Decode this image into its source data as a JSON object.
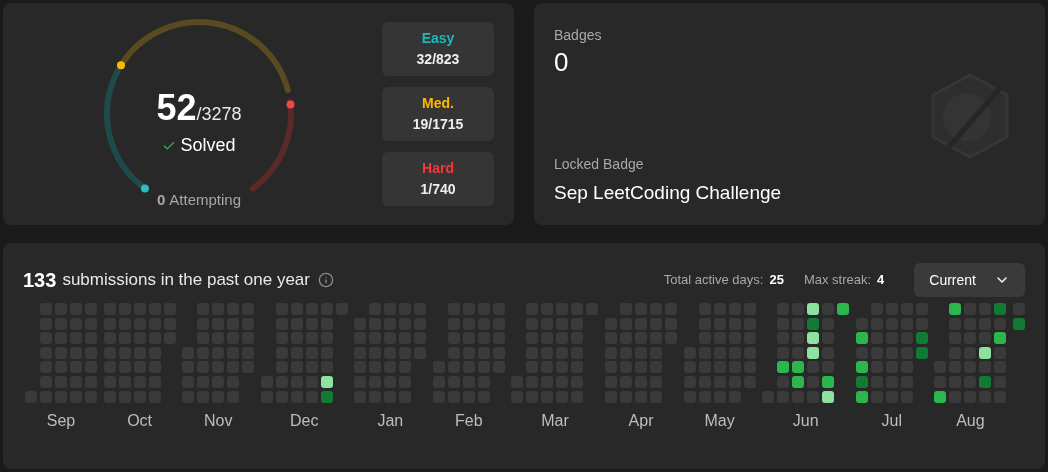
{
  "solved": {
    "count": "52",
    "total": "/3278",
    "label": "Solved",
    "attempting_count": "0",
    "attempting_label": "Attempting"
  },
  "difficulties": [
    {
      "label": "Easy",
      "value": "32/823",
      "color": "#1cbaba"
    },
    {
      "label": "Med.",
      "value": "19/1715",
      "color": "#ffb700"
    },
    {
      "label": "Hard",
      "value": "1/740",
      "color": "#f63737"
    }
  ],
  "badges": {
    "title": "Badges",
    "count": "0",
    "locked_label": "Locked Badge",
    "locked_name": "Sep LeetCoding Challenge"
  },
  "activity": {
    "count": "133",
    "text": "submissions in the past one year",
    "total_active_label": "Total active days:",
    "total_active_value": "25",
    "max_streak_label": "Max streak:",
    "max_streak_value": "4",
    "dropdown": "Current",
    "months": [
      {
        "label": "Sep",
        "weeks": [
          [
            {
              "color": "#3a3a3a"
            }
          ],
          [
            {
              "color": "#3a3a3a"
            },
            {
              "color": "#3a3a3a"
            },
            {
              "color": "#3a3a3a"
            },
            {
              "color": "#3a3a3a"
            },
            {
              "color": "#3a3a3a"
            },
            {
              "color": "#3a3a3a"
            },
            {
              "color": "#3a3a3a"
            }
          ],
          [
            {
              "color": "#3a3a3a"
            },
            {
              "color": "#3a3a3a"
            },
            {
              "color": "#3a3a3a"
            },
            {
              "color": "#3a3a3a"
            },
            {
              "color": "#3a3a3a"
            },
            {
              "color": "#3a3a3a"
            },
            {
              "color": "#3a3a3a"
            }
          ],
          [
            {
              "color": "#3a3a3a"
            },
            {
              "color": "#3a3a3a"
            },
            {
              "color": "#3a3a3a"
            },
            {
              "color": "#3a3a3a"
            },
            {
              "color": "#3a3a3a"
            },
            {
              "color": "#3a3a3a"
            },
            {
              "color": "#3a3a3a"
            }
          ],
          [
            {
              "color": "#3a3a3a"
            },
            {
              "color": "#3a3a3a"
            },
            {
              "color": "#3a3a3a"
            },
            {
              "color": "#3a3a3a"
            },
            {
              "color": "#3a3a3a"
            },
            {
              "color": "#3a3a3a"
            },
            {
              "color": "#3a3a3a"
            }
          ]
        ]
      },
      {
        "label": "Oct",
        "weeks": [
          [
            {
              "color": "#3a3a3a"
            },
            {
              "color": "#3a3a3a"
            },
            {
              "color": "#3a3a3a"
            },
            {
              "color": "#3a3a3a"
            },
            {
              "color": "#3a3a3a"
            },
            {
              "color": "#3a3a3a"
            },
            {
              "color": "#3a3a3a"
            }
          ],
          [
            {
              "color": "#3a3a3a"
            },
            {
              "color": "#3a3a3a"
            },
            {
              "color": "#3a3a3a"
            },
            {
              "color": "#3a3a3a"
            },
            {
              "color": "#3a3a3a"
            },
            {
              "color": "#3a3a3a"
            },
            {
              "color": "#3a3a3a"
            }
          ],
          [
            {
              "color": "#3a3a3a"
            },
            {
              "color": "#3a3a3a"
            },
            {
              "color": "#3a3a3a"
            },
            {
              "color": "#3a3a3a"
            },
            {
              "color": "#3a3a3a"
            },
            {
              "color": "#3a3a3a"
            },
            {
              "color": "#3a3a3a"
            }
          ],
          [
            {
              "color": "#3a3a3a"
            },
            {
              "color": "#3a3a3a"
            },
            {
              "color": "#3a3a3a"
            },
            {
              "color": "#3a3a3a"
            },
            {
              "color": "#3a3a3a"
            },
            {
              "color": "#3a3a3a"
            },
            {
              "color": "#3a3a3a"
            }
          ],
          [
            {
              "color": "#3a3a3a"
            },
            {
              "color": "#3a3a3a"
            },
            {
              "color": "#3a3a3a"
            }
          ]
        ]
      },
      {
        "label": "Nov",
        "weeks": [
          [
            {
              "color": "#3a3a3a"
            },
            {
              "color": "#3a3a3a"
            },
            {
              "color": "#3a3a3a"
            },
            {
              "color": "#3a3a3a"
            }
          ],
          [
            {
              "color": "#3a3a3a"
            },
            {
              "color": "#3a3a3a"
            },
            {
              "color": "#3a3a3a"
            },
            {
              "color": "#3a3a3a"
            },
            {
              "color": "#3a3a3a"
            },
            {
              "color": "#3a3a3a"
            },
            {
              "color": "#3a3a3a"
            }
          ],
          [
            {
              "color": "#3a3a3a"
            },
            {
              "color": "#3a3a3a"
            },
            {
              "color": "#3a3a3a"
            },
            {
              "color": "#3a3a3a"
            },
            {
              "color": "#3a3a3a"
            },
            {
              "color": "#3a3a3a"
            },
            {
              "color": "#3a3a3a"
            }
          ],
          [
            {
              "color": "#3a3a3a"
            },
            {
              "color": "#3a3a3a"
            },
            {
              "color": "#3a3a3a"
            },
            {
              "color": "#3a3a3a"
            },
            {
              "color": "#3a3a3a"
            },
            {
              "color": "#3a3a3a"
            },
            {
              "color": "#3a3a3a"
            }
          ],
          [
            {
              "color": "#3a3a3a"
            },
            {
              "color": "#3a3a3a"
            },
            {
              "color": "#3a3a3a"
            },
            {
              "color": "#3a3a3a"
            },
            {
              "color": "#3a3a3a"
            }
          ]
        ]
      },
      {
        "label": "Dec",
        "weeks": [
          [
            {
              "color": "#3a3a3a"
            },
            {
              "color": "#3a3a3a"
            }
          ],
          [
            {
              "color": "#3a3a3a"
            },
            {
              "color": "#3a3a3a"
            },
            {
              "color": "#3a3a3a"
            },
            {
              "color": "#3a3a3a"
            },
            {
              "color": "#3a3a3a"
            },
            {
              "color": "#3a3a3a"
            },
            {
              "color": "#3a3a3a"
            }
          ],
          [
            {
              "color": "#3a3a3a"
            },
            {
              "color": "#3a3a3a"
            },
            {
              "color": "#3a3a3a"
            },
            {
              "color": "#3a3a3a"
            },
            {
              "color": "#3a3a3a"
            },
            {
              "color": "#3a3a3a"
            },
            {
              "color": "#3a3a3a"
            }
          ],
          [
            {
              "color": "#3a3a3a"
            },
            {
              "color": "#3a3a3a"
            },
            {
              "color": "#3a3a3a"
            },
            {
              "color": "#3a3a3a"
            },
            {
              "color": "#3a3a3a"
            },
            {
              "color": "#3a3a3a"
            },
            {
              "color": "#3a3a3a"
            }
          ],
          [
            {
              "color": "#3a3a3a"
            },
            {
              "color": "#3a3a3a"
            },
            {
              "color": "#3a3a3a"
            },
            {
              "color": "#3a3a3a"
            },
            {
              "color": "#3a3a3a"
            },
            {
              "color": "#8ee29f"
            },
            {
              "color": "#137a33"
            }
          ],
          [
            {
              "color": "#3a3a3a"
            }
          ]
        ]
      },
      {
        "label": "Jan",
        "weeks": [
          [
            {
              "color": "#3a3a3a"
            },
            {
              "color": "#3a3a3a"
            },
            {
              "color": "#3a3a3a"
            },
            {
              "color": "#3a3a3a"
            },
            {
              "color": "#3a3a3a"
            },
            {
              "color": "#3a3a3a"
            }
          ],
          [
            {
              "color": "#3a3a3a"
            },
            {
              "color": "#3a3a3a"
            },
            {
              "color": "#3a3a3a"
            },
            {
              "color": "#3a3a3a"
            },
            {
              "color": "#3a3a3a"
            },
            {
              "color": "#3a3a3a"
            },
            {
              "color": "#3a3a3a"
            }
          ],
          [
            {
              "color": "#3a3a3a"
            },
            {
              "color": "#3a3a3a"
            },
            {
              "color": "#3a3a3a"
            },
            {
              "color": "#3a3a3a"
            },
            {
              "color": "#3a3a3a"
            },
            {
              "color": "#3a3a3a"
            },
            {
              "color": "#3a3a3a"
            }
          ],
          [
            {
              "color": "#3a3a3a"
            },
            {
              "color": "#3a3a3a"
            },
            {
              "color": "#3a3a3a"
            },
            {
              "color": "#3a3a3a"
            },
            {
              "color": "#3a3a3a"
            },
            {
              "color": "#3a3a3a"
            },
            {
              "color": "#3a3a3a"
            }
          ],
          [
            {
              "color": "#3a3a3a"
            },
            {
              "color": "#3a3a3a"
            },
            {
              "color": "#3a3a3a"
            },
            {
              "color": "#3a3a3a"
            }
          ]
        ]
      },
      {
        "label": "Feb",
        "weeks": [
          [
            {
              "color": "#3a3a3a"
            },
            {
              "color": "#3a3a3a"
            },
            {
              "color": "#3a3a3a"
            }
          ],
          [
            {
              "color": "#3a3a3a"
            },
            {
              "color": "#3a3a3a"
            },
            {
              "color": "#3a3a3a"
            },
            {
              "color": "#3a3a3a"
            },
            {
              "color": "#3a3a3a"
            },
            {
              "color": "#3a3a3a"
            },
            {
              "color": "#3a3a3a"
            }
          ],
          [
            {
              "color": "#3a3a3a"
            },
            {
              "color": "#3a3a3a"
            },
            {
              "color": "#3a3a3a"
            },
            {
              "color": "#3a3a3a"
            },
            {
              "color": "#3a3a3a"
            },
            {
              "color": "#3a3a3a"
            },
            {
              "color": "#3a3a3a"
            }
          ],
          [
            {
              "color": "#3a3a3a"
            },
            {
              "color": "#3a3a3a"
            },
            {
              "color": "#3a3a3a"
            },
            {
              "color": "#3a3a3a"
            },
            {
              "color": "#3a3a3a"
            },
            {
              "color": "#3a3a3a"
            },
            {
              "color": "#3a3a3a"
            }
          ],
          [
            {
              "color": "#3a3a3a"
            },
            {
              "color": "#3a3a3a"
            },
            {
              "color": "#3a3a3a"
            },
            {
              "color": "#3a3a3a"
            },
            {
              "color": "#3a3a3a"
            }
          ]
        ]
      },
      {
        "label": "Mar",
        "weeks": [
          [
            {
              "color": "#3a3a3a"
            },
            {
              "color": "#3a3a3a"
            }
          ],
          [
            {
              "color": "#3a3a3a"
            },
            {
              "color": "#3a3a3a"
            },
            {
              "color": "#3a3a3a"
            },
            {
              "color": "#3a3a3a"
            },
            {
              "color": "#3a3a3a"
            },
            {
              "color": "#3a3a3a"
            },
            {
              "color": "#3a3a3a"
            }
          ],
          [
            {
              "color": "#3a3a3a"
            },
            {
              "color": "#3a3a3a"
            },
            {
              "color": "#3a3a3a"
            },
            {
              "color": "#3a3a3a"
            },
            {
              "color": "#3a3a3a"
            },
            {
              "color": "#3a3a3a"
            },
            {
              "color": "#3a3a3a"
            }
          ],
          [
            {
              "color": "#3a3a3a"
            },
            {
              "color": "#3a3a3a"
            },
            {
              "color": "#3a3a3a"
            },
            {
              "color": "#3a3a3a"
            },
            {
              "color": "#3a3a3a"
            },
            {
              "color": "#3a3a3a"
            },
            {
              "color": "#3a3a3a"
            }
          ],
          [
            {
              "color": "#3a3a3a"
            },
            {
              "color": "#3a3a3a"
            },
            {
              "color": "#3a3a3a"
            },
            {
              "color": "#3a3a3a"
            },
            {
              "color": "#3a3a3a"
            },
            {
              "color": "#3a3a3a"
            },
            {
              "color": "#3a3a3a"
            }
          ],
          [
            {
              "color": "#3a3a3a"
            }
          ]
        ]
      },
      {
        "label": "Apr",
        "weeks": [
          [
            {
              "color": "#3a3a3a"
            },
            {
              "color": "#3a3a3a"
            },
            {
              "color": "#3a3a3a"
            },
            {
              "color": "#3a3a3a"
            },
            {
              "color": "#3a3a3a"
            },
            {
              "color": "#3a3a3a"
            }
          ],
          [
            {
              "color": "#3a3a3a"
            },
            {
              "color": "#3a3a3a"
            },
            {
              "color": "#3a3a3a"
            },
            {
              "color": "#3a3a3a"
            },
            {
              "color": "#3a3a3a"
            },
            {
              "color": "#3a3a3a"
            },
            {
              "color": "#3a3a3a"
            }
          ],
          [
            {
              "color": "#3a3a3a"
            },
            {
              "color": "#3a3a3a"
            },
            {
              "color": "#3a3a3a"
            },
            {
              "color": "#3a3a3a"
            },
            {
              "color": "#3a3a3a"
            },
            {
              "color": "#3a3a3a"
            },
            {
              "color": "#3a3a3a"
            }
          ],
          [
            {
              "color": "#3a3a3a"
            },
            {
              "color": "#3a3a3a"
            },
            {
              "color": "#3a3a3a"
            },
            {
              "color": "#3a3a3a"
            },
            {
              "color": "#3a3a3a"
            },
            {
              "color": "#3a3a3a"
            },
            {
              "color": "#3a3a3a"
            }
          ],
          [
            {
              "color": "#3a3a3a"
            },
            {
              "color": "#3a3a3a"
            },
            {
              "color": "#3a3a3a"
            }
          ]
        ]
      },
      {
        "label": "May",
        "weeks": [
          [
            {
              "color": "#3a3a3a"
            },
            {
              "color": "#3a3a3a"
            },
            {
              "color": "#3a3a3a"
            },
            {
              "color": "#3a3a3a"
            }
          ],
          [
            {
              "color": "#3a3a3a"
            },
            {
              "color": "#3a3a3a"
            },
            {
              "color": "#3a3a3a"
            },
            {
              "color": "#3a3a3a"
            },
            {
              "color": "#3a3a3a"
            },
            {
              "color": "#3a3a3a"
            },
            {
              "color": "#3a3a3a"
            }
          ],
          [
            {
              "color": "#3a3a3a"
            },
            {
              "color": "#3a3a3a"
            },
            {
              "color": "#3a3a3a"
            },
            {
              "color": "#3a3a3a"
            },
            {
              "color": "#3a3a3a"
            },
            {
              "color": "#3a3a3a"
            },
            {
              "color": "#3a3a3a"
            }
          ],
          [
            {
              "color": "#3a3a3a"
            },
            {
              "color": "#3a3a3a"
            },
            {
              "color": "#3a3a3a"
            },
            {
              "color": "#3a3a3a"
            },
            {
              "color": "#3a3a3a"
            },
            {
              "color": "#3a3a3a"
            },
            {
              "color": "#3a3a3a"
            }
          ],
          [
            {
              "color": "#3a3a3a"
            },
            {
              "color": "#3a3a3a"
            },
            {
              "color": "#3a3a3a"
            },
            {
              "color": "#3a3a3a"
            },
            {
              "color": "#3a3a3a"
            },
            {
              "color": "#3a3a3a"
            }
          ]
        ]
      },
      {
        "label": "Jun",
        "weeks": [
          [
            {
              "color": "#3a3a3a"
            }
          ],
          [
            {
              "color": "#3a3a3a"
            },
            {
              "color": "#3a3a3a"
            },
            {
              "color": "#3a3a3a"
            },
            {
              "color": "#3a3a3a"
            },
            {
              "color": "#2bb74d"
            },
            {
              "color": "#3a3a3a"
            },
            {
              "color": "#3a3a3a"
            }
          ],
          [
            {
              "color": "#3a3a3a"
            },
            {
              "color": "#3a3a3a"
            },
            {
              "color": "#3a3a3a"
            },
            {
              "color": "#3a3a3a"
            },
            {
              "color": "#2bb74d"
            },
            {
              "color": "#2bb74d"
            },
            {
              "color": "#3a3a3a"
            }
          ],
          [
            {
              "color": "#8ee29f"
            },
            {
              "color": "#137a33"
            },
            {
              "color": "#8ee29f"
            },
            {
              "color": "#8ee29f"
            },
            {
              "color": "#3a3a3a"
            },
            {
              "color": "#3a3a3a"
            },
            {
              "color": "#3a3a3a"
            }
          ],
          [
            {
              "color": "#3a3a3a"
            },
            {
              "color": "#3a3a3a"
            },
            {
              "color": "#3a3a3a"
            },
            {
              "color": "#3a3a3a"
            },
            {
              "color": "#3a3a3a"
            },
            {
              "color": "#2bb74d"
            },
            {
              "color": "#8ee29f"
            }
          ],
          [
            {
              "color": "#2bb74d"
            }
          ]
        ]
      },
      {
        "label": "Jul",
        "weeks": [
          [
            {
              "color": "#3a3a3a"
            },
            {
              "color": "#2bb74d"
            },
            {
              "color": "#3a3a3a"
            },
            {
              "color": "#2bb74d"
            },
            {
              "color": "#137a33"
            },
            {
              "color": "#2bb74d"
            }
          ],
          [
            {
              "color": "#3a3a3a"
            },
            {
              "color": "#3a3a3a"
            },
            {
              "color": "#3a3a3a"
            },
            {
              "color": "#3a3a3a"
            },
            {
              "color": "#3a3a3a"
            },
            {
              "color": "#3a3a3a"
            },
            {
              "color": "#3a3a3a"
            }
          ],
          [
            {
              "color": "#3a3a3a"
            },
            {
              "color": "#3a3a3a"
            },
            {
              "color": "#3a3a3a"
            },
            {
              "color": "#3a3a3a"
            },
            {
              "color": "#3a3a3a"
            },
            {
              "color": "#3a3a3a"
            },
            {
              "color": "#3a3a3a"
            }
          ],
          [
            {
              "color": "#3a3a3a"
            },
            {
              "color": "#3a3a3a"
            },
            {
              "color": "#3a3a3a"
            },
            {
              "color": "#3a3a3a"
            },
            {
              "color": "#3a3a3a"
            },
            {
              "color": "#3a3a3a"
            },
            {
              "color": "#3a3a3a"
            }
          ],
          [
            {
              "color": "#3a3a3a"
            },
            {
              "color": "#3a3a3a"
            },
            {
              "color": "#137a33"
            },
            {
              "color": "#137a33"
            }
          ]
        ]
      },
      {
        "label": "Aug",
        "weeks": [
          [
            {
              "color": "#3a3a3a"
            },
            {
              "color": "#3a3a3a"
            },
            {
              "color": "#2bb74d"
            }
          ],
          [
            {
              "color": "#2bb74d"
            },
            {
              "color": "#3a3a3a"
            },
            {
              "color": "#3a3a3a"
            },
            {
              "color": "#3a3a3a"
            },
            {
              "color": "#3a3a3a"
            },
            {
              "color": "#3a3a3a"
            },
            {
              "color": "#3a3a3a"
            }
          ],
          [
            {
              "color": "#3a3a3a"
            },
            {
              "color": "#3a3a3a"
            },
            {
              "color": "#3a3a3a"
            },
            {
              "color": "#3a3a3a"
            },
            {
              "color": "#3a3a3a"
            },
            {
              "color": "#3a3a3a"
            },
            {
              "color": "#3a3a3a"
            }
          ],
          [
            {
              "color": "#3a3a3a"
            },
            {
              "color": "#3a3a3a"
            },
            {
              "color": "#3a3a3a"
            },
            {
              "color": "#8ee29f"
            },
            {
              "color": "#3a3a3a"
            },
            {
              "color": "#137a33"
            },
            {
              "color": "#3a3a3a"
            }
          ],
          [
            {
              "color": "#137a33"
            },
            {
              "color": "#3a3a3a"
            },
            {
              "color": "#2bb74d"
            },
            {
              "color": "#3a3a3a"
            },
            {
              "color": "#3a3a3a"
            },
            {
              "color": "#3a3a3a"
            },
            {
              "color": "#3a3a3a"
            }
          ]
        ]
      },
      {
        "weeks": [
          [
            {
              "color": "#3a3a3a"
            },
            {
              "color": "#137a33"
            }
          ]
        ]
      }
    ]
  }
}
